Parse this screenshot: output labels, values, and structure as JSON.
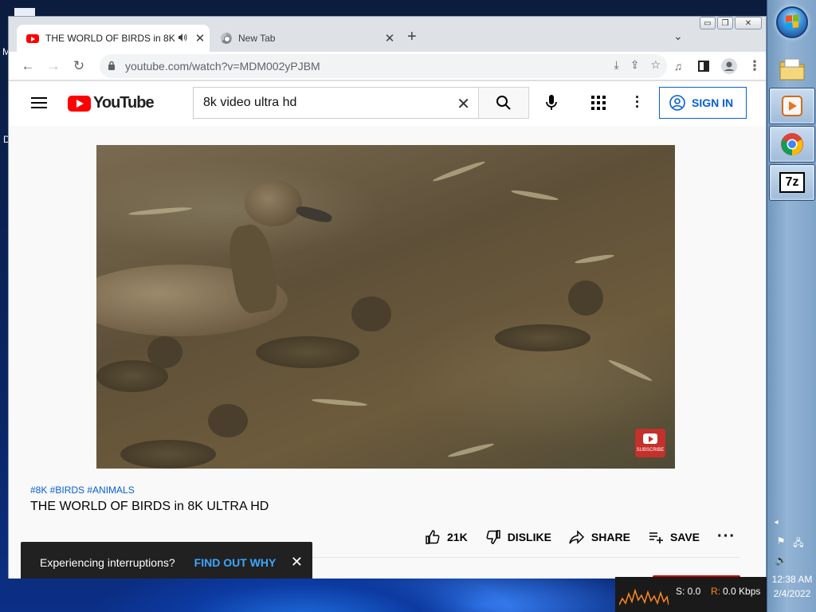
{
  "desktop": {
    "edge_letters": [
      "M",
      "D"
    ]
  },
  "browser": {
    "tabs": [
      {
        "title": "THE WORLD OF BIRDS in 8K",
        "active": true,
        "audio_icon": "speaker-icon"
      },
      {
        "title": "New Tab",
        "active": false
      }
    ],
    "url": "youtube.com/watch?v=MDM002yPJBM"
  },
  "youtube": {
    "logo_text": "YouTube",
    "search_value": "8k video ultra hd",
    "signin_label": "SIGN IN",
    "video": {
      "subscribe_watermark": "SUBSCRIBE"
    },
    "hashtags": "#8K #BIRDS #ANIMALS",
    "title": "THE WORLD OF BIRDS in 8K ULTRA HD",
    "likes": "21K",
    "dislike_label": "DISLIKE",
    "share_label": "SHARE",
    "save_label": "SAVE",
    "toast": {
      "message": "Experiencing interruptions?",
      "action": "FIND OUT WHY"
    }
  },
  "taskbar": {
    "time": "12:38 AM",
    "date": "2/4/2022",
    "net_send": "S: 0.0",
    "net_recv_label": "R:",
    "net_recv": "0.0 Kbps",
    "seven_zip_label": "7z"
  },
  "colors": {
    "youtube_red": "#ff0000",
    "link_blue": "#065fd4",
    "toast_link": "#3ea6ff"
  }
}
